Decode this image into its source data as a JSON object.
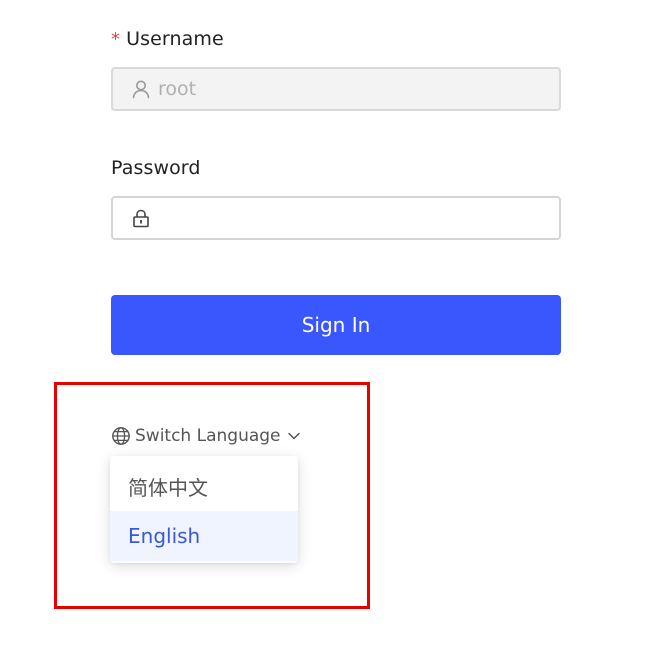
{
  "form": {
    "username_label": "Username",
    "username_required_mark": "*",
    "username_value": "root",
    "password_label": "Password",
    "password_value": "",
    "signin_label": "Sign In"
  },
  "language": {
    "switch_label": "Switch Language",
    "options": [
      {
        "label": "简体中文",
        "selected": false
      },
      {
        "label": "English",
        "selected": true
      }
    ]
  },
  "colors": {
    "primary": "#3a57fe",
    "required": "#e0453d",
    "selected_bg": "#eff4ff",
    "selected_text": "#3a57d9",
    "highlight": "#e60000"
  },
  "icons": {
    "username_prefix": "user-icon",
    "password_prefix": "lock-icon",
    "language": "globe-icon",
    "dropdown": "chevron-down-icon"
  }
}
